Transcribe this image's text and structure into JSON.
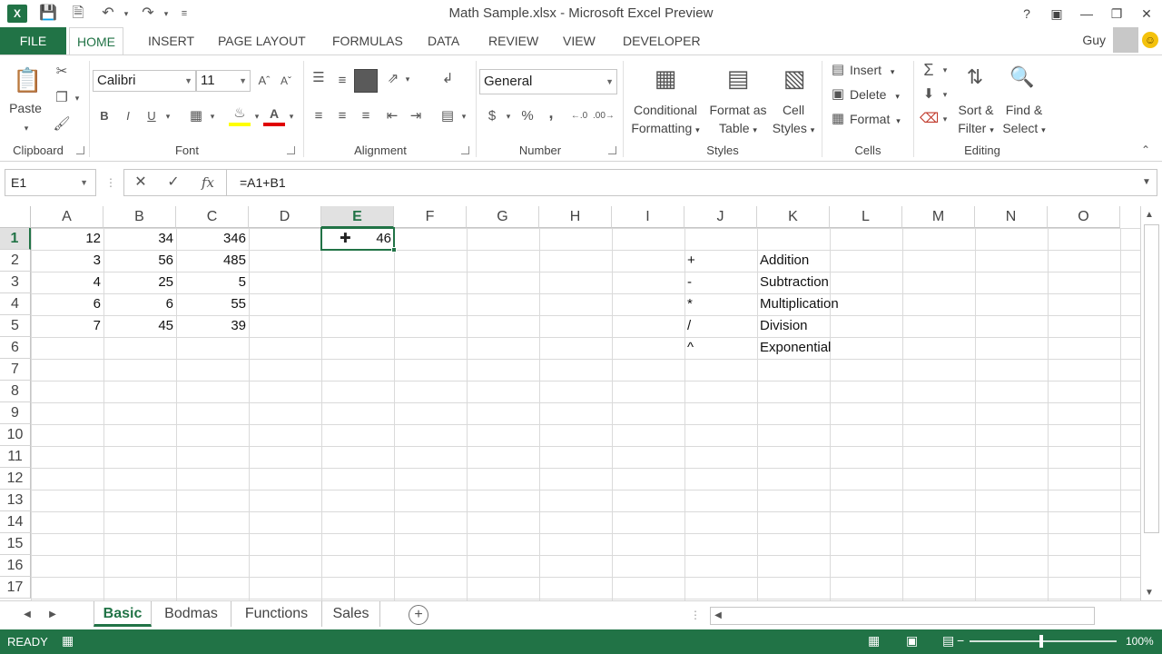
{
  "app": {
    "title": "Math Sample.xlsx - Microsoft Excel Preview",
    "logo": "X",
    "user": "Guy"
  },
  "tabs": [
    "HOME",
    "INSERT",
    "PAGE LAYOUT",
    "FORMULAS",
    "DATA",
    "REVIEW",
    "VIEW",
    "DEVELOPER"
  ],
  "file_tab": "FILE",
  "ribbon": {
    "clipboard": {
      "label": "Clipboard",
      "paste": "Paste"
    },
    "font": {
      "label": "Font",
      "name": "Calibri",
      "size": "11",
      "bold": "B",
      "italic": "I",
      "underline": "U"
    },
    "alignment": {
      "label": "Alignment"
    },
    "number": {
      "label": "Number",
      "format": "General",
      "currency": "$",
      "percent": "%",
      "comma": ","
    },
    "styles": {
      "label": "Styles",
      "conditional_1": "Conditional",
      "conditional_2": "Formatting",
      "format_as_1": "Format as",
      "format_as_2": "Table",
      "cell_styles_1": "Cell",
      "cell_styles_2": "Styles"
    },
    "cells": {
      "label": "Cells",
      "insert": "Insert",
      "delete": "Delete",
      "format": "Format"
    },
    "editing": {
      "label": "Editing",
      "sort_1": "Sort &",
      "sort_2": "Filter",
      "find_1": "Find &",
      "find_2": "Select"
    }
  },
  "formula_bar": {
    "name_box": "E1",
    "formula": "=A1+B1",
    "fx": "fx"
  },
  "columns": [
    "A",
    "B",
    "C",
    "D",
    "E",
    "F",
    "G",
    "H",
    "I",
    "J",
    "K",
    "L",
    "M",
    "N",
    "O"
  ],
  "rows": [
    "1",
    "2",
    "3",
    "4",
    "5",
    "6",
    "7",
    "8",
    "9",
    "10",
    "11",
    "12",
    "13",
    "14",
    "15",
    "16",
    "17"
  ],
  "selected": {
    "column": "E",
    "row": "1"
  },
  "cells": {
    "A": [
      "12",
      "3",
      "4",
      "6",
      "7"
    ],
    "B": [
      "34",
      "56",
      "25",
      "6",
      "45"
    ],
    "C": [
      "346",
      "485",
      "5",
      "55",
      "39"
    ],
    "E1": "46",
    "J": [
      "+",
      "-",
      "*",
      "/",
      "^"
    ],
    "K": [
      "Addition",
      "Subtraction",
      "Multiplication",
      "Division",
      "Exponential"
    ]
  },
  "sheets": [
    "Basic",
    "Bodmas",
    "Functions",
    "Sales"
  ],
  "active_sheet": "Basic",
  "status": {
    "text": "READY",
    "zoom": "100%"
  },
  "colors": {
    "accent": "#217346",
    "text": "#444444"
  }
}
